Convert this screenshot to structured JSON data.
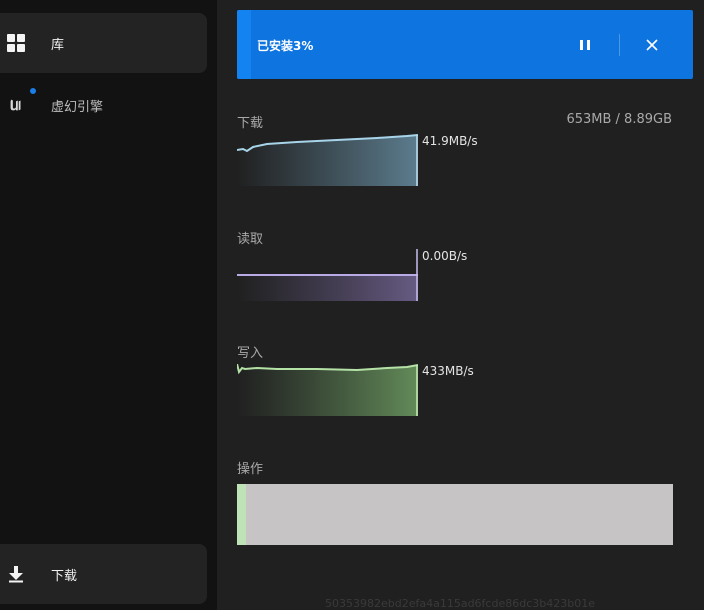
{
  "sidebar": {
    "items": [
      {
        "label": "库",
        "icon": "grid-icon"
      },
      {
        "label": "虚幻引擎",
        "icon": "unreal-engine-logo-icon"
      },
      {
        "label": "下载",
        "icon": "download-arrow-icon"
      }
    ]
  },
  "banner": {
    "status": "已安装3%",
    "progress_percent": 3,
    "pause_icon": "pause-icon",
    "close_icon": "close-icon",
    "color": "#0e74e0"
  },
  "download": {
    "label": "下载",
    "size": "653MB / 8.89GB",
    "rate": "41.9MB/s"
  },
  "read": {
    "label": "读取",
    "rate": "0.00B/s"
  },
  "write": {
    "label": "写入",
    "rate": "433MB/s"
  },
  "operations": {
    "label": "操作",
    "progress_percent": 2
  },
  "footer": {
    "watermark": "50353982ebd2efa4a115ad6fcde86dc3b423b01e"
  }
}
